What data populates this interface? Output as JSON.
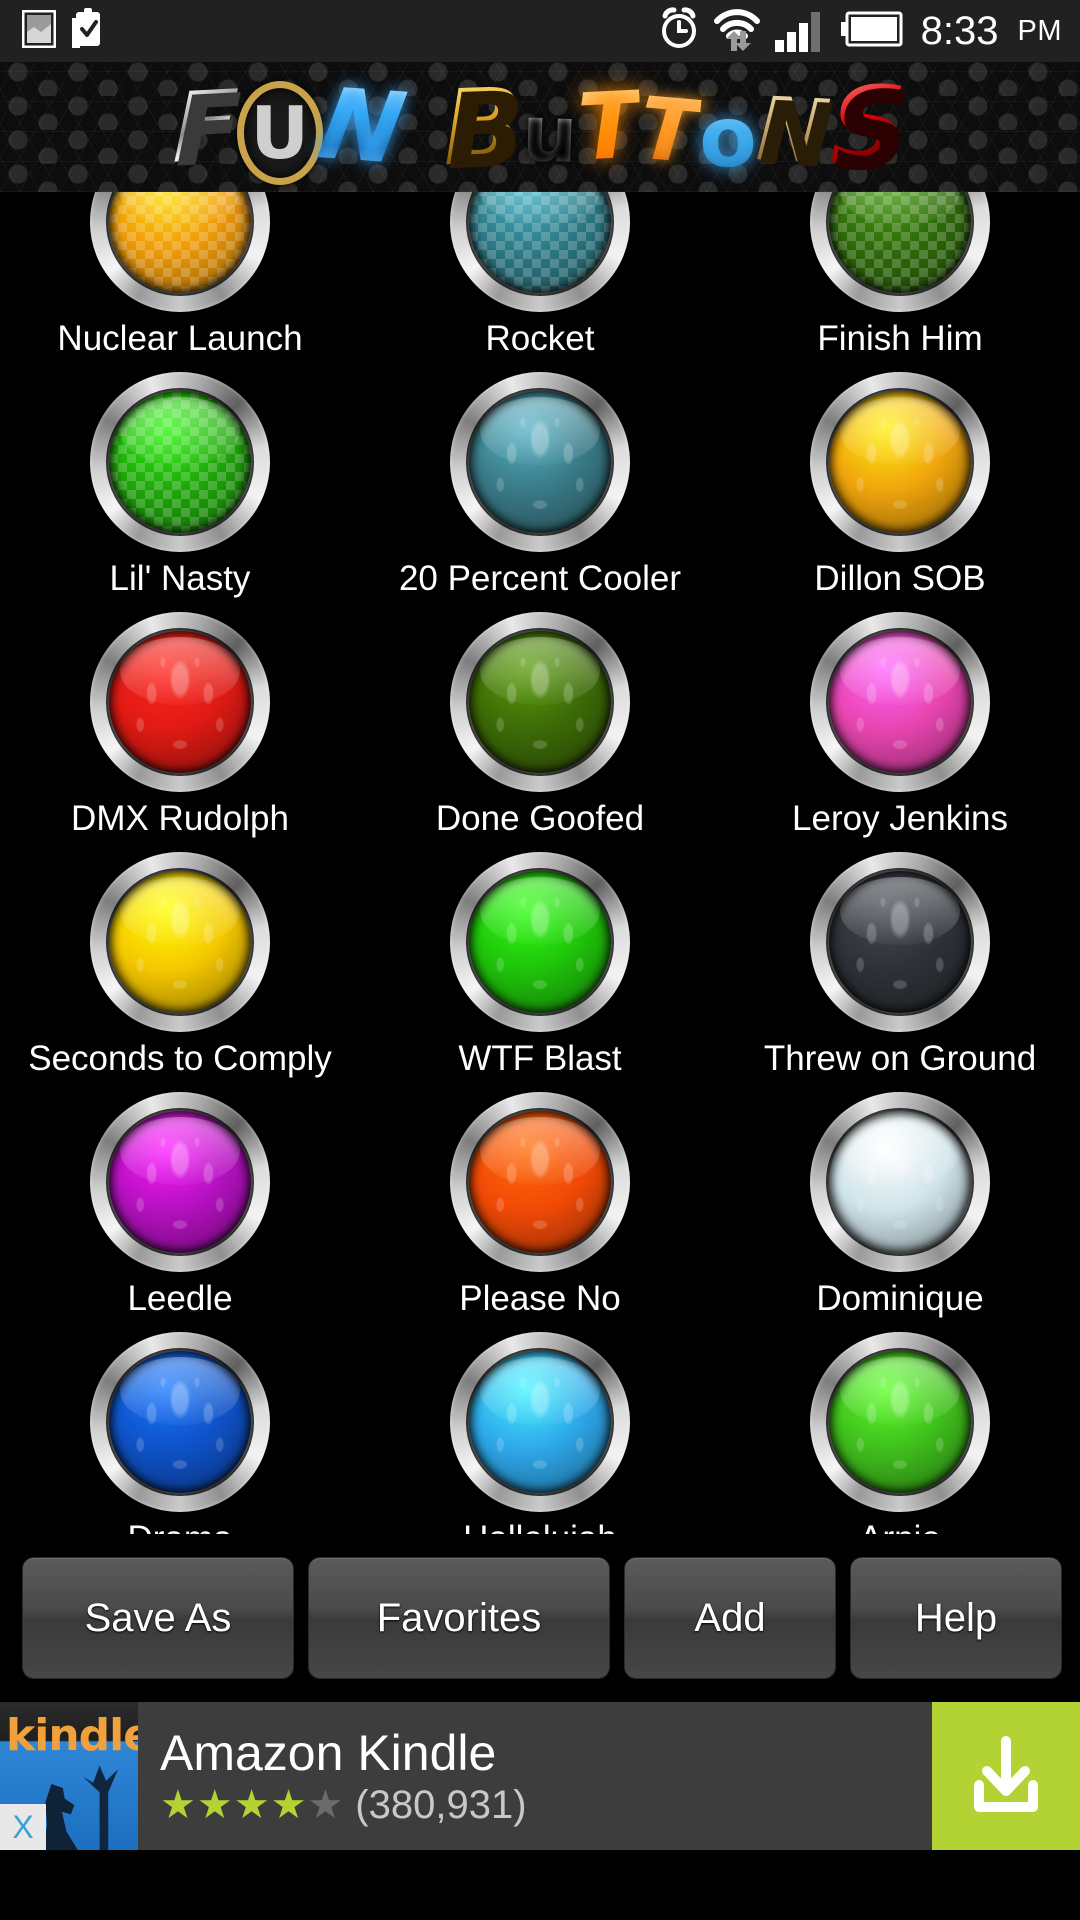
{
  "status_bar": {
    "left_icons": [
      "screenshot-icon",
      "clipboard-check-icon"
    ],
    "right_icons": [
      "alarm-clock-icon",
      "wifi-transfer-icon",
      "signal-bars-icon",
      "battery-icon"
    ],
    "time": "8:33",
    "ampm": "PM"
  },
  "header": {
    "title": "FUN BUTTONS",
    "letters": [
      "F",
      "U",
      "N",
      "B",
      "u",
      "T",
      "T",
      "o",
      "N",
      "S"
    ]
  },
  "grid": {
    "rows": [
      [
        {
          "label": "Nuclear Launch",
          "color": "#ef9b0a",
          "pattern": "checker"
        },
        {
          "label": "Rocket",
          "color": "#2d7b87",
          "pattern": "checker"
        },
        {
          "label": "Finish Him",
          "color": "#2f6b0a",
          "pattern": "checker"
        }
      ],
      [
        {
          "label": "Lil' Nasty",
          "color": "#1fa80a",
          "pattern": "checker"
        },
        {
          "label": "20 Percent Cooler",
          "color": "#3a7b88",
          "pattern": "damask"
        },
        {
          "label": "Dillon SOB",
          "color": "#f0a50c",
          "pattern": "damask"
        }
      ],
      [
        {
          "label": "DMX Rudolph",
          "color": "#e01a14",
          "pattern": "damask"
        },
        {
          "label": "Done Goofed",
          "color": "#3d6b07",
          "pattern": "damask"
        },
        {
          "label": "Leroy Jenkins",
          "color": "#e845b0",
          "pattern": "damask"
        }
      ],
      [
        {
          "label": "Seconds to Comply",
          "color": "#f5c800",
          "pattern": "damask"
        },
        {
          "label": "WTF Blast",
          "color": "#1fc40a",
          "pattern": "damask"
        },
        {
          "label": "Threw on Ground",
          "color": "#2e3238",
          "pattern": "damask"
        }
      ],
      [
        {
          "label": "Leedle",
          "color": "#b511c0",
          "pattern": "damask"
        },
        {
          "label": "Please No",
          "color": "#f24a06",
          "pattern": "damask"
        },
        {
          "label": "Dominique",
          "color": "#cfe4ea",
          "pattern": "damask"
        }
      ],
      [
        {
          "label": "Drama",
          "color": "#0f52c8",
          "pattern": "damask"
        },
        {
          "label": "Hallelujah",
          "color": "#2ea8ea",
          "pattern": "damask"
        },
        {
          "label": "Arnie",
          "color": "#3fbf1c",
          "pattern": "damask"
        }
      ]
    ]
  },
  "toolbar": {
    "save_as": "Save As",
    "favorites": "Favorites",
    "add": "Add",
    "help": "Help"
  },
  "ad": {
    "icon_word": "kindle",
    "title": "Amazon Kindle",
    "stars_filled": 4,
    "stars_total": 5,
    "review_count": "(380,931)",
    "close_label": "X",
    "cta_icon": "download-icon",
    "cta_color": "#b3d233"
  }
}
